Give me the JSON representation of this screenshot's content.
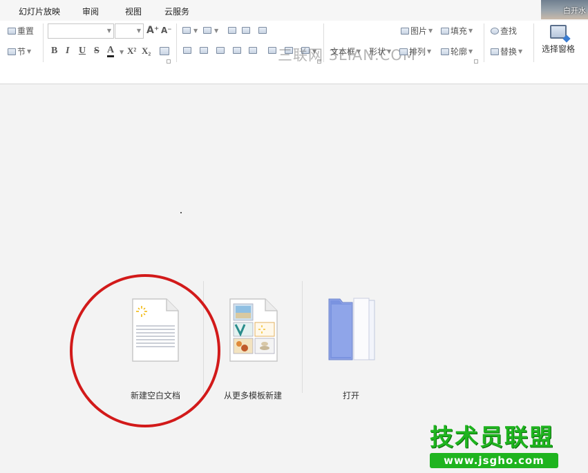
{
  "menubar": {
    "items": [
      {
        "label": "幻灯片放映"
      },
      {
        "label": "审阅"
      },
      {
        "label": "视图"
      },
      {
        "label": "云服务"
      }
    ],
    "user_label": "白开水"
  },
  "ribbon": {
    "reset_label": "重置",
    "section_label": "节",
    "font_name_value": "",
    "font_size_value": "",
    "grow_font_label": "A⁺",
    "shrink_font_label": "A⁻",
    "bold_label": "B",
    "italic_label": "I",
    "underline_label": "U",
    "strike_label": "S",
    "font_color_label": "A",
    "superscript_label": "X²",
    "subscript_label": "X₂",
    "textbox_label": "文本框",
    "shape_label": "形状",
    "arrange_label": "排列",
    "picture_label": "图片",
    "fill_label": "填充",
    "outline_label": "轮廓",
    "find_label": "查找",
    "replace_label": "替换",
    "selection_pane_label": "选择窗格",
    "watermark_text": "三联网 3LIAN.COM"
  },
  "start_page": {
    "new_blank_label": "新建空白文档",
    "from_template_label": "从更多模板新建",
    "open_label": "打开"
  },
  "site_logo": {
    "title": "技术员联盟",
    "url": "www.jsgho.com"
  },
  "colors": {
    "circle": "#d21a1a",
    "logo_green": "#1fb41f",
    "folder_blue": "#7a93e0"
  }
}
